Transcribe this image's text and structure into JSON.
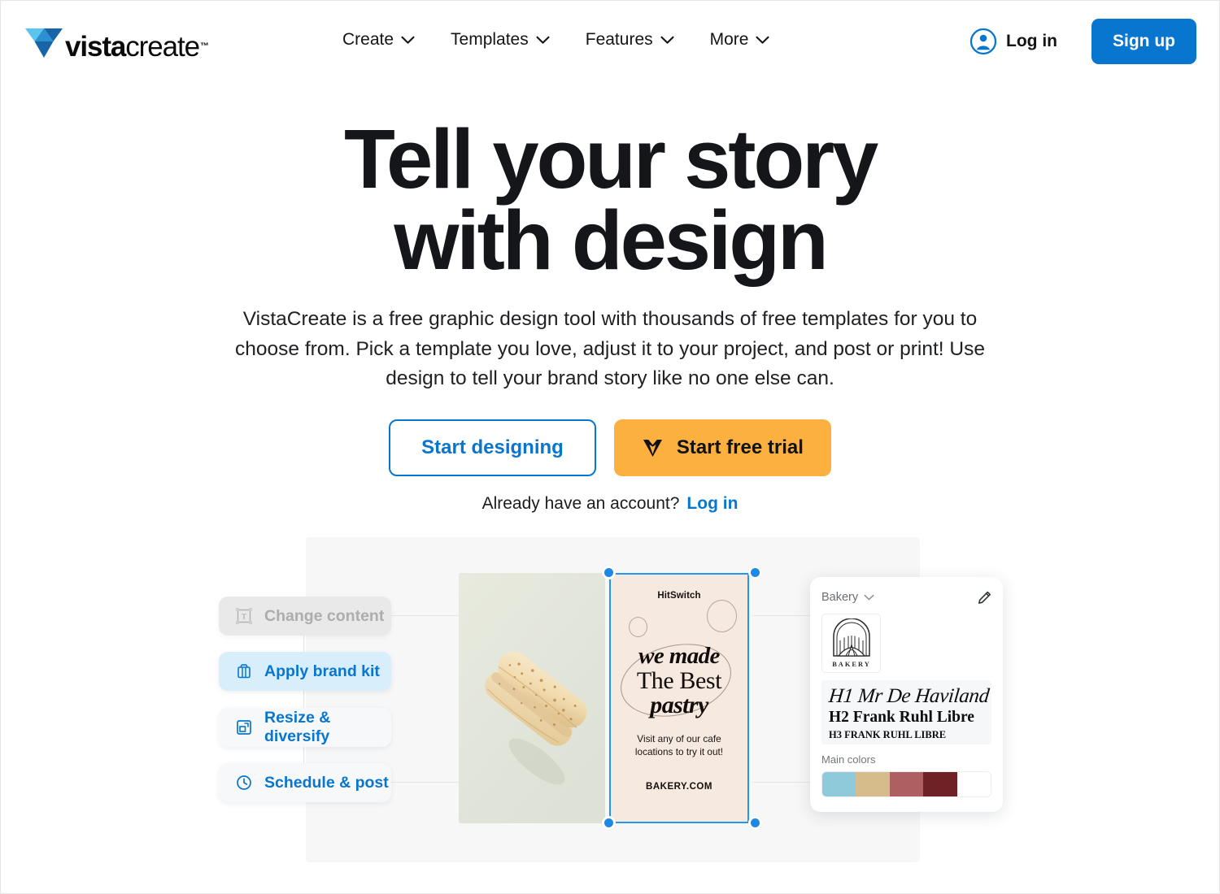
{
  "brand": {
    "name_bold": "vista",
    "name_light": "create",
    "trademark": "™",
    "logo_icon": "vistacreate-v-logo-icon",
    "logo_colors": {
      "light": "#5bc5f2",
      "mid": "#2c8fd0",
      "dark": "#1565a8"
    }
  },
  "nav": {
    "items": [
      {
        "label": "Create",
        "icon": "chevron-down-icon"
      },
      {
        "label": "Templates",
        "icon": "chevron-down-icon"
      },
      {
        "label": "Features",
        "icon": "chevron-down-icon"
      },
      {
        "label": "More",
        "icon": "chevron-down-icon"
      }
    ],
    "login_label": "Log in",
    "login_icon": "user-avatar-icon",
    "signup_label": "Sign up",
    "signup_color": "#0876ce"
  },
  "hero": {
    "headline_line1": "Tell your story",
    "headline_line2": "with design",
    "subhead": "VistaCreate is a free graphic design tool with thousands of free templates for you to choose from. Pick a template you love, adjust it to your project, and post or print! Use design to tell your brand story like no one else can.",
    "primary_cta": "Start designing",
    "secondary_cta": "Start free trial",
    "secondary_cta_icon": "diamond-gem-icon",
    "secondary_cta_color": "#fbb040",
    "account_prompt": "Already have an account?",
    "account_login": "Log in"
  },
  "illustration": {
    "chips": [
      {
        "label": "Change content",
        "icon": "text-box-icon",
        "state": "disabled",
        "bg": "#e9e9e9",
        "fg": "#adadad"
      },
      {
        "label": "Apply brand kit",
        "icon": "brand-kit-bag-icon",
        "state": "active",
        "bg": "#d9eefb",
        "fg": "#0876ce"
      },
      {
        "label": "Resize & diversify",
        "icon": "resize-frame-icon",
        "state": "default",
        "bg": "#f7f8f9",
        "fg": "#0876ce"
      },
      {
        "label": "Schedule & post",
        "icon": "clock-icon",
        "state": "default",
        "bg": "#f7f8f9",
        "fg": "#0876ce"
      }
    ],
    "photo_card": {
      "subject": "eclair-pastry-photo",
      "background_color": "#e3e6dd"
    },
    "design_card": {
      "selected": true,
      "brand_tag": "HitSwitch",
      "title_line1": "we made",
      "title_line2": "The Best",
      "title_line3": "pastry",
      "body": "Visit any of our cafe locations to try it out!",
      "url": "BAKERY.COM",
      "background": "#f6e9e0",
      "selection_color": "#2196f3"
    },
    "brand_kit": {
      "title": "Bakery",
      "title_icon": "chevron-down-icon",
      "edit_icon": "pencil-edit-icon",
      "logo_icon": "bakery-arch-logo-icon",
      "logo_caption": "BAKERY",
      "font_h1": "H1 Mr De Haviland",
      "font_h2": "H2 Frank Ruhl Libre",
      "font_h3": "H3 FRANK RUHL LIBRE",
      "colors_label": "Main colors",
      "swatches": [
        "#8ecad9",
        "#d6bc8a",
        "#ae5f62",
        "#6e2226",
        "#ffffff"
      ]
    }
  }
}
